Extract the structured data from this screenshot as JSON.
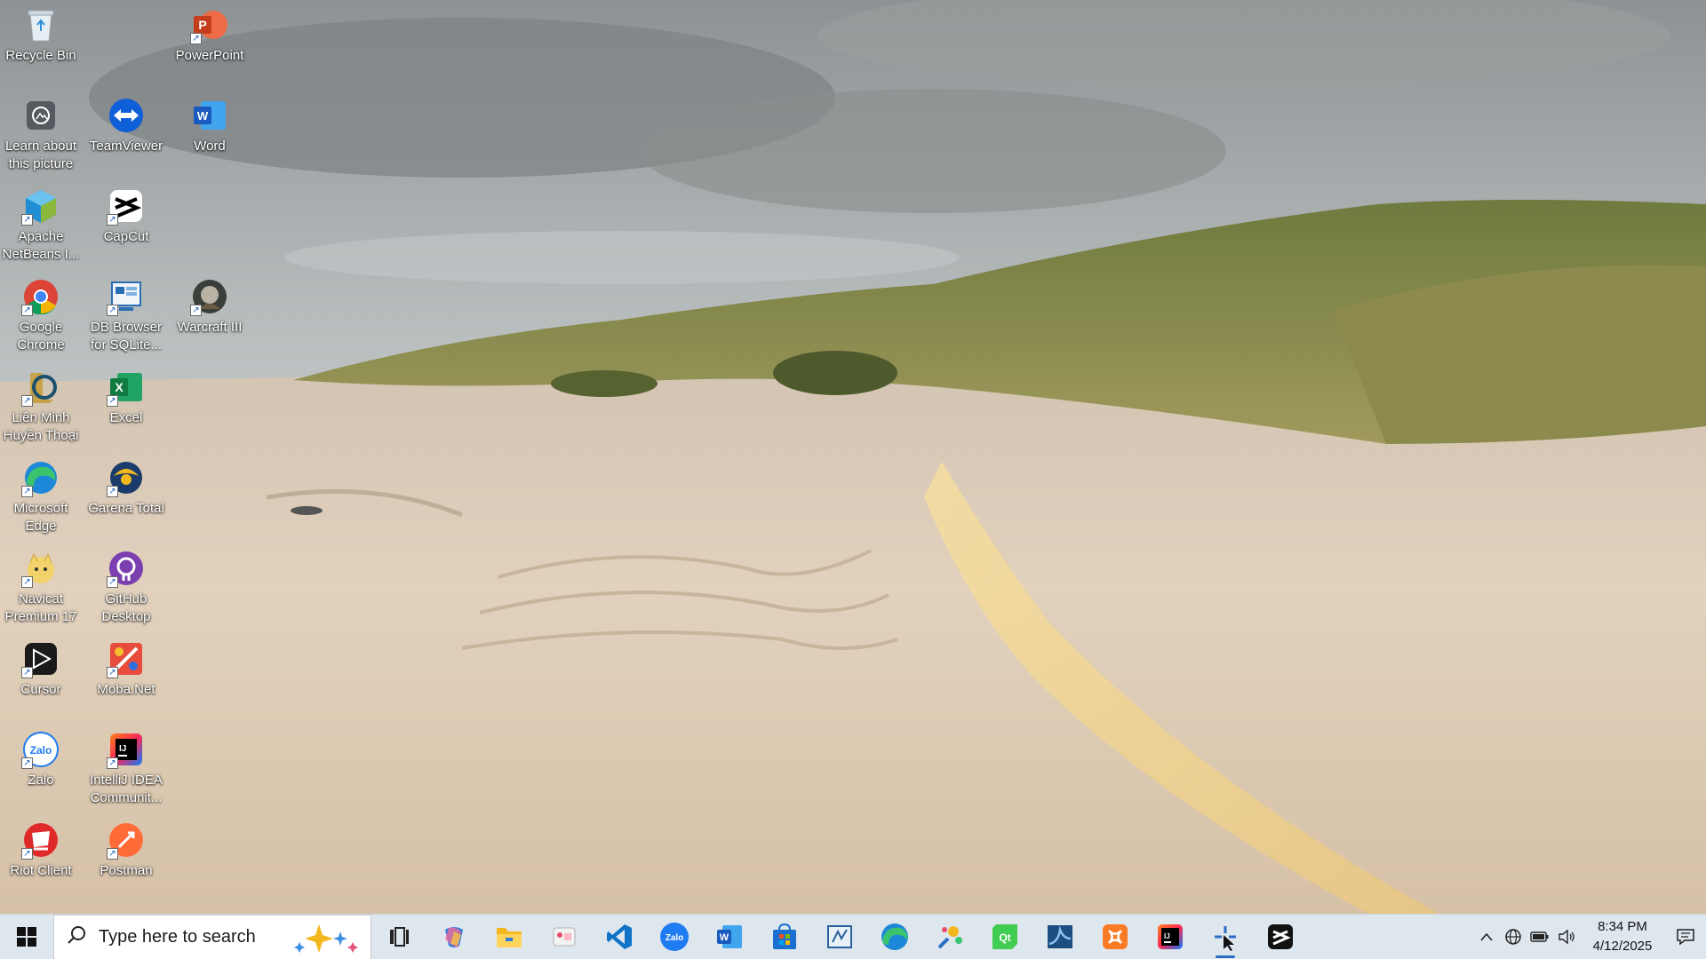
{
  "desktop": {
    "icons": [
      {
        "label": "Recycle Bin",
        "icon": "recycle-bin-icon"
      },
      {
        "label": "PowerPoint",
        "icon": "powerpoint-icon"
      },
      {
        "label": "Learn about this picture",
        "icon": "learn-picture-icon"
      },
      {
        "label": "TeamViewer",
        "icon": "teamviewer-icon"
      },
      {
        "label": "Word",
        "icon": "word-icon"
      },
      {
        "label": "Apache NetBeans I...",
        "icon": "netbeans-icon"
      },
      {
        "label": "CapCut",
        "icon": "capcut-icon"
      },
      {
        "label": "Google Chrome",
        "icon": "chrome-icon"
      },
      {
        "label": "DB Browser for SQLite...",
        "icon": "db-browser-icon"
      },
      {
        "label": "Warcraft III",
        "icon": "warcraft-icon"
      },
      {
        "label": "Liên Minh Huyền Thoại",
        "icon": "league-icon"
      },
      {
        "label": "Excel",
        "icon": "excel-icon"
      },
      {
        "label": "Microsoft Edge",
        "icon": "edge-icon"
      },
      {
        "label": "Garena Total",
        "icon": "garena-icon"
      },
      {
        "label": "Navicat Premium 17",
        "icon": "navicat-icon"
      },
      {
        "label": "GitHub Desktop",
        "icon": "github-desktop-icon"
      },
      {
        "label": "Cursor",
        "icon": "cursor-app-icon"
      },
      {
        "label": "Moba.Net",
        "icon": "mobanet-icon"
      },
      {
        "label": "Zalo",
        "icon": "zalo-icon"
      },
      {
        "label": "IntelliJ IDEA Communit...",
        "icon": "intellij-icon"
      },
      {
        "label": "Riot Client",
        "icon": "riot-client-icon"
      },
      {
        "label": "Postman",
        "icon": "postman-icon"
      }
    ]
  },
  "taskbar": {
    "search_placeholder": "Type here to search",
    "pinned": [
      {
        "name": "task-view",
        "icon": "task-view-icon"
      },
      {
        "name": "copilot",
        "icon": "copilot-icon"
      },
      {
        "name": "file-explorer",
        "icon": "folder-icon"
      },
      {
        "name": "snipping",
        "icon": "snipping-icon"
      },
      {
        "name": "vscode",
        "icon": "vscode-icon"
      },
      {
        "name": "zalo",
        "icon": "zalo-icon"
      },
      {
        "name": "word",
        "icon": "word-icon"
      },
      {
        "name": "store",
        "icon": "store-icon"
      },
      {
        "name": "sql-tool",
        "icon": "sql-tool-icon"
      },
      {
        "name": "edge",
        "icon": "edge-icon"
      },
      {
        "name": "paint",
        "icon": "paint-icon"
      },
      {
        "name": "qt",
        "icon": "qt-icon"
      },
      {
        "name": "wireshark",
        "icon": "wireshark-icon"
      },
      {
        "name": "xampp",
        "icon": "xampp-icon"
      },
      {
        "name": "intellij",
        "icon": "intellij-icon"
      },
      {
        "name": "recorder",
        "icon": "recorder-icon"
      },
      {
        "name": "capcut",
        "icon": "capcut-icon"
      }
    ],
    "clock": {
      "time": "8:34 PM",
      "date": "4/12/2025"
    }
  },
  "colors": {
    "taskbar_bg": "#dfe7ee",
    "accent": "#2b6cc4"
  }
}
